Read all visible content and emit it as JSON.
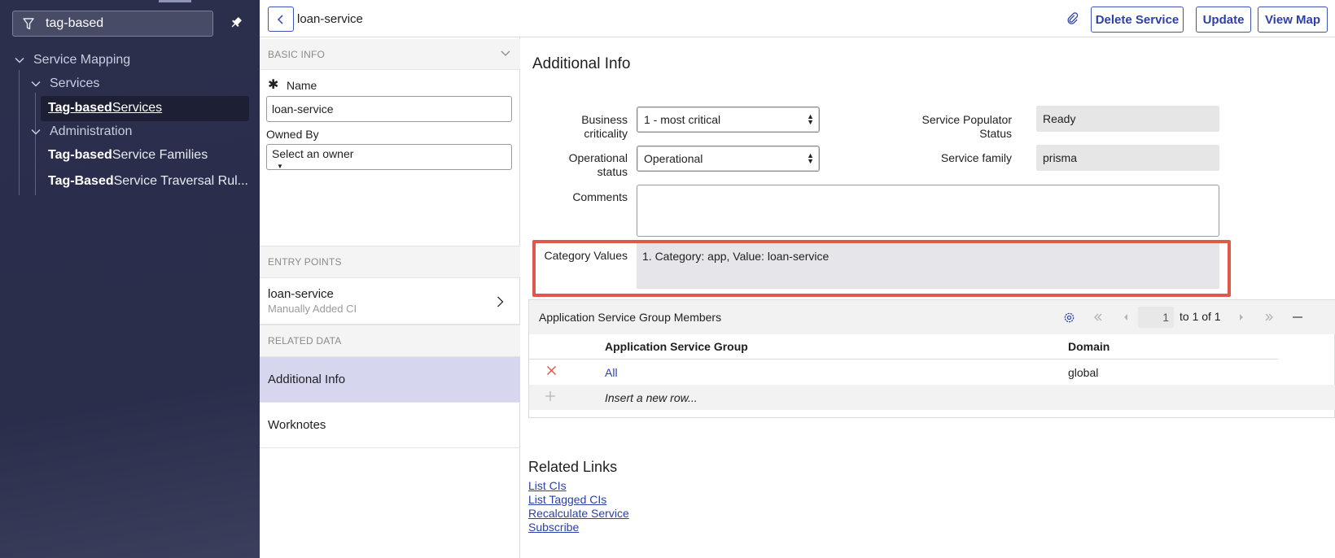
{
  "sidebar": {
    "filter_value": "tag-based",
    "items": [
      {
        "label": "Service Mapping"
      },
      {
        "label": "Services"
      },
      {
        "bold": "Tag-based",
        "rest": " Services"
      },
      {
        "label": "Administration"
      },
      {
        "bold": "Tag-based",
        "rest": " Service Families"
      },
      {
        "bold": "Tag-Based",
        "rest": " Service Traversal Rul..."
      }
    ]
  },
  "header": {
    "title": "loan-service",
    "buttons": {
      "delete": "Delete Service",
      "update": "Update",
      "view_map": "View Map"
    }
  },
  "left_panel": {
    "basic_info": "BASIC INFO",
    "name_label": "Name",
    "name_value": "loan-service",
    "owned_by_label": "Owned By",
    "owned_by_value": "Select an owner",
    "entry_points": "ENTRY POINTS",
    "entry_name": "loan-service",
    "entry_sub": "Manually Added CI",
    "related_data": "RELATED DATA",
    "nav": [
      "Additional Info",
      "Worknotes"
    ]
  },
  "form": {
    "title": "Additional Info",
    "business_criticality_label": "Business criticality",
    "business_criticality_value": "1 - most critical",
    "operational_status_label": "Operational status",
    "operational_status_value": "Operational",
    "service_populator_label": "Service Populator Status",
    "service_populator_value": "Ready",
    "service_family_label": "Service family",
    "service_family_value": "prisma",
    "comments_label": "Comments",
    "category_values_label": "Category Values",
    "category_values_value": "1. Category: app, Value: loan-service"
  },
  "related_list": {
    "title": "Application Service Group Members",
    "page_number": "1",
    "page_text": "to 1 of 1",
    "columns": [
      "Application Service Group",
      "Domain"
    ],
    "rows": [
      {
        "group": "All",
        "domain": "global"
      }
    ],
    "insert_row": "Insert a new row..."
  },
  "related_links": {
    "title": "Related Links",
    "links": [
      "List CIs",
      "List Tagged CIs",
      "Recalculate Service",
      "Subscribe"
    ]
  },
  "colors": {
    "sidebar": "#2b2f4c",
    "accent": "#3f55b5",
    "highlight": "#e2574c",
    "active_nav": "#d6d7ef"
  }
}
